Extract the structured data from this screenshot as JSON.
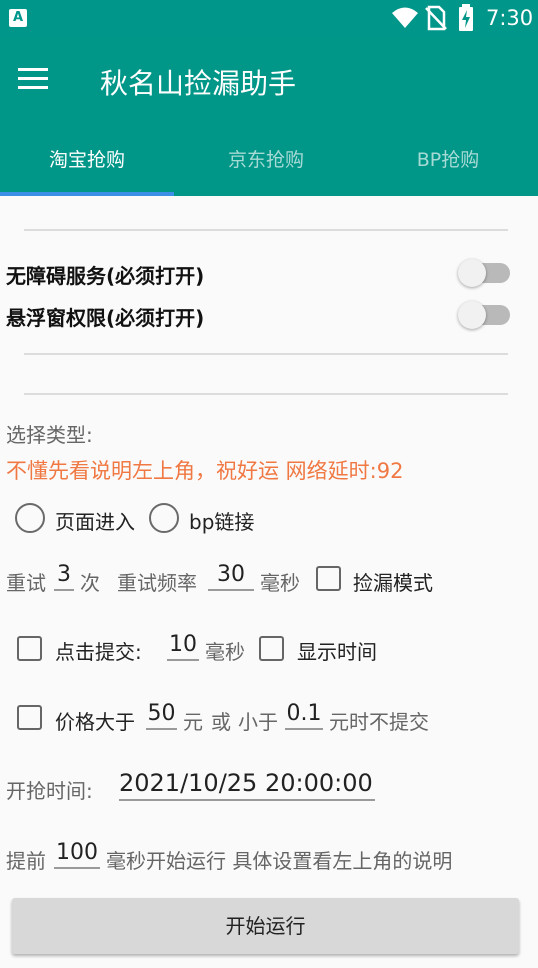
{
  "status_bar": {
    "time": "7:30",
    "app_badge": "A"
  },
  "toolbar": {
    "title": "秋名山捡漏助手"
  },
  "tabs": [
    {
      "label": "淘宝抢购",
      "active": true
    },
    {
      "label": "京东抢购",
      "active": false
    },
    {
      "label": "BP抢购",
      "active": false
    }
  ],
  "permissions": {
    "accessibility_label": "无障碍服务(必须打开)",
    "accessibility_on": false,
    "overlay_label": "悬浮窗权限(必须打开)",
    "overlay_on": false
  },
  "select_type_label": "选择类型:",
  "notice": "不懂先看说明左上角，祝好运 网络延时:92",
  "radios": {
    "page_entry": "页面进入",
    "bp_link": "bp链接"
  },
  "retry": {
    "label": "重试",
    "count": "3",
    "count_unit": "次",
    "freq_label": "重试频率",
    "freq_value": "30",
    "freq_unit": "毫秒",
    "pickup_mode": "捡漏模式"
  },
  "click_submit": {
    "label": "点击提交:",
    "value": "10",
    "unit": "毫秒",
    "show_time": "显示时间"
  },
  "price": {
    "label": "价格大于",
    "greater_value": "50",
    "unit1": "元",
    "or": "或",
    "less_label": "小于",
    "less_value": "0.1",
    "suffix": "元时不提交"
  },
  "start_time": {
    "label": "开抢时间:",
    "value": "2021/10/25 20:00:00"
  },
  "advance": {
    "prefix": "提前",
    "value": "100",
    "suffix": "毫秒开始运行 具体设置看左上角的说明"
  },
  "start_button": "开始运行",
  "colors": {
    "primary": "#009688",
    "accent": "#3d8fe6",
    "notice": "#f07843"
  }
}
